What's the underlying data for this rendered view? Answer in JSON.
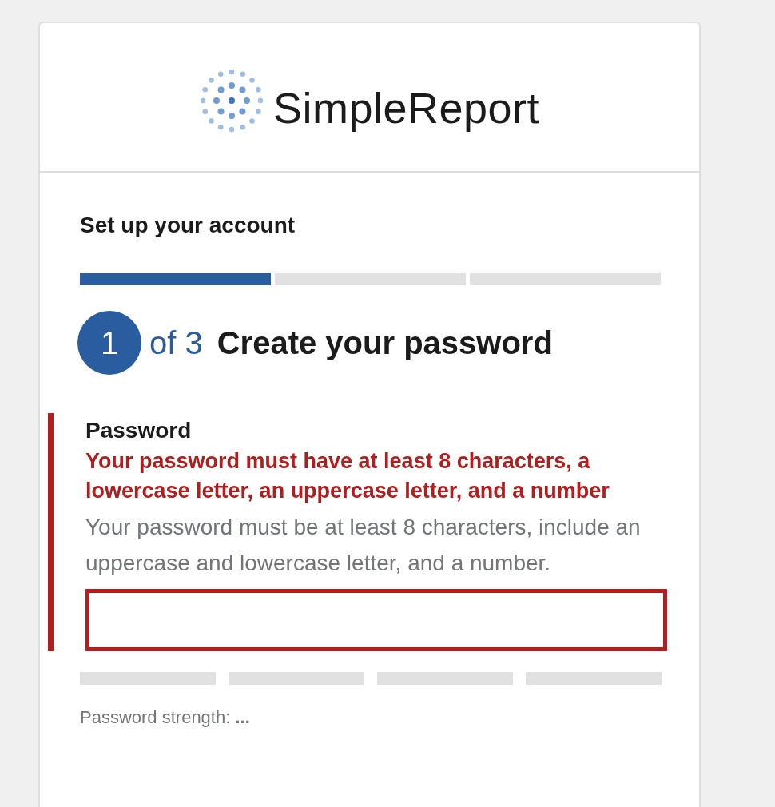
{
  "logo": {
    "text": "SimpleReport"
  },
  "title": "Set up your account",
  "steps": [
    {
      "complete": true
    },
    {
      "complete": false
    },
    {
      "complete": false
    }
  ],
  "step_indicator": {
    "current": "1",
    "total": "of 3",
    "heading": "Create your password"
  },
  "password_field": {
    "label": "Password",
    "error": true,
    "error_message": "Your password must have at least 8 characters, a lowercase letter, an uppercase letter, and a number",
    "hint": "Your password must be at least 8 characters, include an uppercase and lowercase letter, and a number."
  },
  "strength_bars": [
    {
      "filled": false
    },
    {
      "filled": false
    },
    {
      "filled": false
    },
    {
      "filled": false
    }
  ],
  "strength_text": "Password strength: **...**"
}
